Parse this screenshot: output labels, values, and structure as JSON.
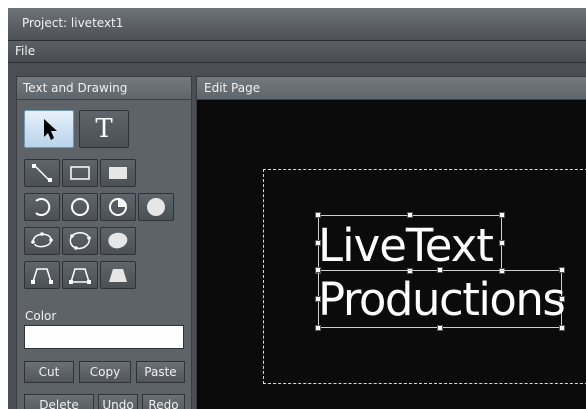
{
  "window": {
    "title": "Project: livetext1"
  },
  "menu": {
    "file": "File"
  },
  "left_panel": {
    "title": "Text and Drawing",
    "tools": {
      "select": "arrow-pointer-icon",
      "text": "T"
    },
    "color_label": "Color",
    "color_value": "#ffffff",
    "buttons": {
      "cut": "Cut",
      "copy": "Copy",
      "paste": "Paste",
      "delete": "Delete",
      "undo": "Undo",
      "redo": "Redo"
    }
  },
  "edit_panel": {
    "title": "Edit Page",
    "canvas_text": {
      "line1": "LiveText",
      "line2": "Productions"
    }
  },
  "colors": {
    "canvas_bg": "#0b0b0b",
    "panel_bg": "#5d6367",
    "selected_tool_bg": "#cfe2f3"
  }
}
